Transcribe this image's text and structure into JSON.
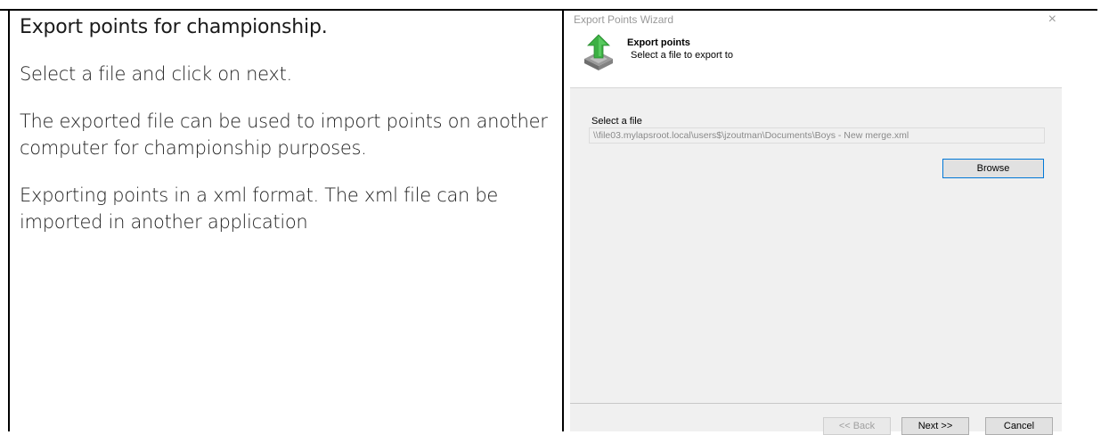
{
  "description": {
    "title": "Export points for championship.",
    "p1": "Select a file and click on next.",
    "p2": "The exported file can be used to import points on another computer for championship purposes.",
    "p3": "Exporting points in a xml format. The xml file can be imported in another application"
  },
  "wizard": {
    "window_title": "Export Points Wizard",
    "close_glyph": "×",
    "header_title": "Export points",
    "header_subtitle": "Select a file to export to",
    "icon": "export-arrow-icon",
    "file_label": "Select a file",
    "file_path": "\\\\file03.mylapsroot.local\\users$\\jzoutman\\Documents\\Boys - New merge.xml",
    "browse_label": "Browse",
    "back_label": "<< Back",
    "next_label": "Next >>",
    "cancel_label": "Cancel"
  },
  "colors": {
    "focus_border": "#0078d7",
    "icon_green": "#3cb043",
    "window_bg": "#f0f0f0"
  }
}
